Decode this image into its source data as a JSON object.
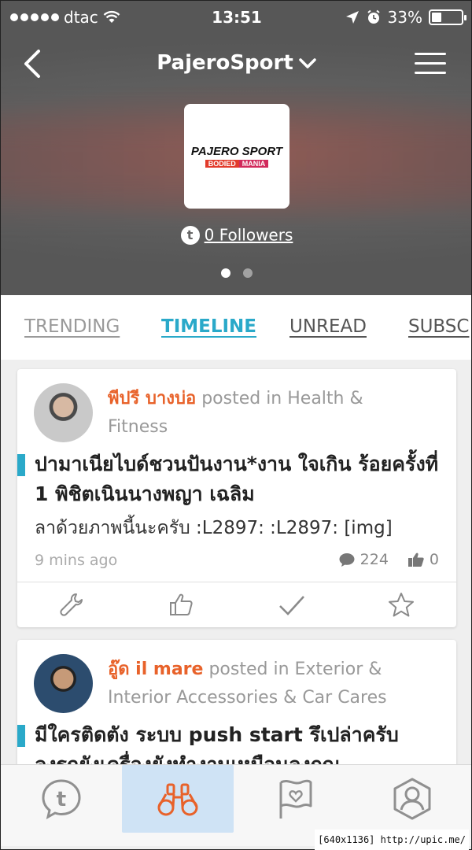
{
  "status_bar": {
    "carrier": "dtac",
    "time": "13:51",
    "battery": "33%",
    "battery_fraction": 0.33
  },
  "nav": {
    "title": "PajeroSport"
  },
  "club": {
    "logo_line1": "PAJERO SPORT",
    "logo_line2_left": "BODIED",
    "logo_line2_right": "MANIA",
    "followers": "0 Followers"
  },
  "tabs": [
    {
      "label": "TRENDING"
    },
    {
      "label": "TIMELINE"
    },
    {
      "label": "UNREAD"
    },
    {
      "label": "SUBSC"
    }
  ],
  "posts": [
    {
      "author": "พีปรี บางบ่อ",
      "posted_in": "posted in Health & Fitness",
      "title": "ปามาเนียไบด์ชวนปันงาน*งาน ใจเกิน ร้อยครั้งที่ 1 พิชิตเนินนางพญา เฉลิม",
      "excerpt": "ลาด้วยภาพนี้นะครับ :L2897: :L2897: [img]",
      "time": "9 mins ago",
      "comments": "224",
      "likes": "0"
    },
    {
      "author": "อู๊ด il mare",
      "posted_in": "posted in Exterior & Interior Accessories & Car Cares",
      "title": "มีใครติดตัง ระบบ push start รึเปล่าครับ",
      "title_cut": "ลงรถยังเครื่องยังทำงานเหมือนลงกุญ"
    }
  ],
  "footer": "[640x1136] http://upic.me/",
  "colors": {
    "accent": "#2aa9c9",
    "author": "#e8622a",
    "active_tab_bg": "#cfe3f5"
  }
}
